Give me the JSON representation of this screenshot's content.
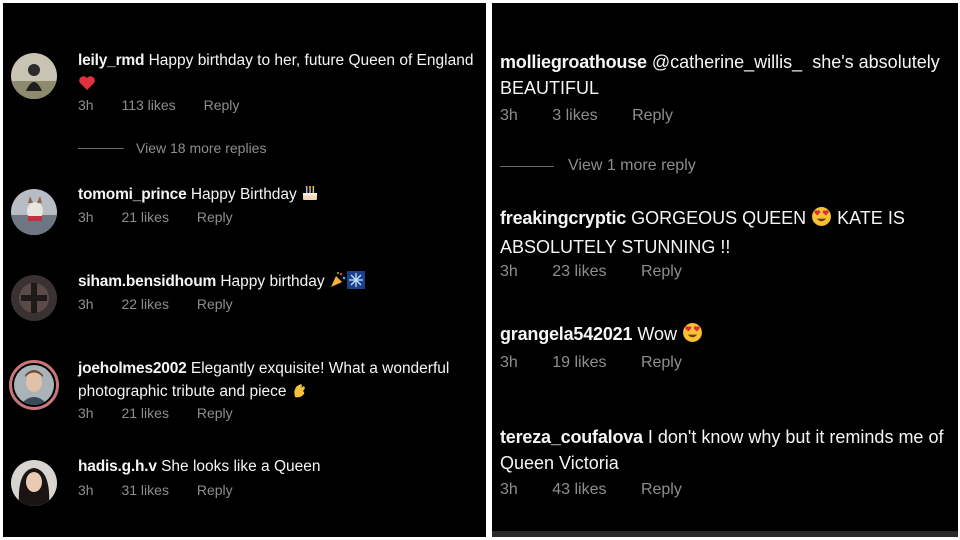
{
  "left": {
    "comments": [
      {
        "username": "leily_rmd",
        "text": "Happy birthday to her, future Queen of England",
        "emoji": "heart-icon",
        "time": "3h",
        "likes": "113 likes",
        "reply": "Reply",
        "view_more": "View 18 more replies"
      },
      {
        "username": "tomomi_prince",
        "text": "Happy Birthday",
        "emoji": "cake-icon",
        "time": "3h",
        "likes": "21 likes",
        "reply": "Reply"
      },
      {
        "username": "siham.bensidhoum",
        "text": "Happy birthday",
        "emoji": "party-popper-and-fireworks-icons",
        "time": "3h",
        "likes": "22 likes",
        "reply": "Reply"
      },
      {
        "username": "joeholmes2002",
        "text": "Elegantly exquisite! What a wonderful photographic tribute and piece",
        "emoji": "clapping-hand-icon",
        "time": "3h",
        "likes": "21 likes",
        "reply": "Reply"
      },
      {
        "username": "hadis.g.h.v",
        "text": "She looks like a Queen",
        "time": "3h",
        "likes": "31 likes",
        "reply": "Reply"
      }
    ]
  },
  "right": {
    "comments": [
      {
        "username": "molliegroathouse",
        "mention": "@catherine_willis_",
        "text": "she's absolutely BEAUTIFUL",
        "time": "3h",
        "likes": "3 likes",
        "reply": "Reply",
        "view_more": "View 1 more reply"
      },
      {
        "username": "freakingcryptic",
        "text_a": "GORGEOUS QUEEN",
        "emoji": "heart-eyes-icon",
        "text_b": "KATE IS ABSOLUTELY STUNNING !!",
        "time": "3h",
        "likes": "23 likes",
        "reply": "Reply"
      },
      {
        "username": "grangela542021",
        "text": "Wow",
        "emoji": "heart-eyes-icon",
        "time": "3h",
        "likes": "19 likes",
        "reply": "Reply"
      },
      {
        "username": "tereza_coufalova",
        "text": "I don't know why but it reminds me of Queen Victoria",
        "time": "3h",
        "likes": "43 likes",
        "reply": "Reply"
      }
    ]
  },
  "colors": {
    "background": "#000000",
    "text": "#f5f5f5",
    "muted": "#8e8e8e",
    "heart": "#e0323c",
    "story_ring": "#c9757a"
  }
}
